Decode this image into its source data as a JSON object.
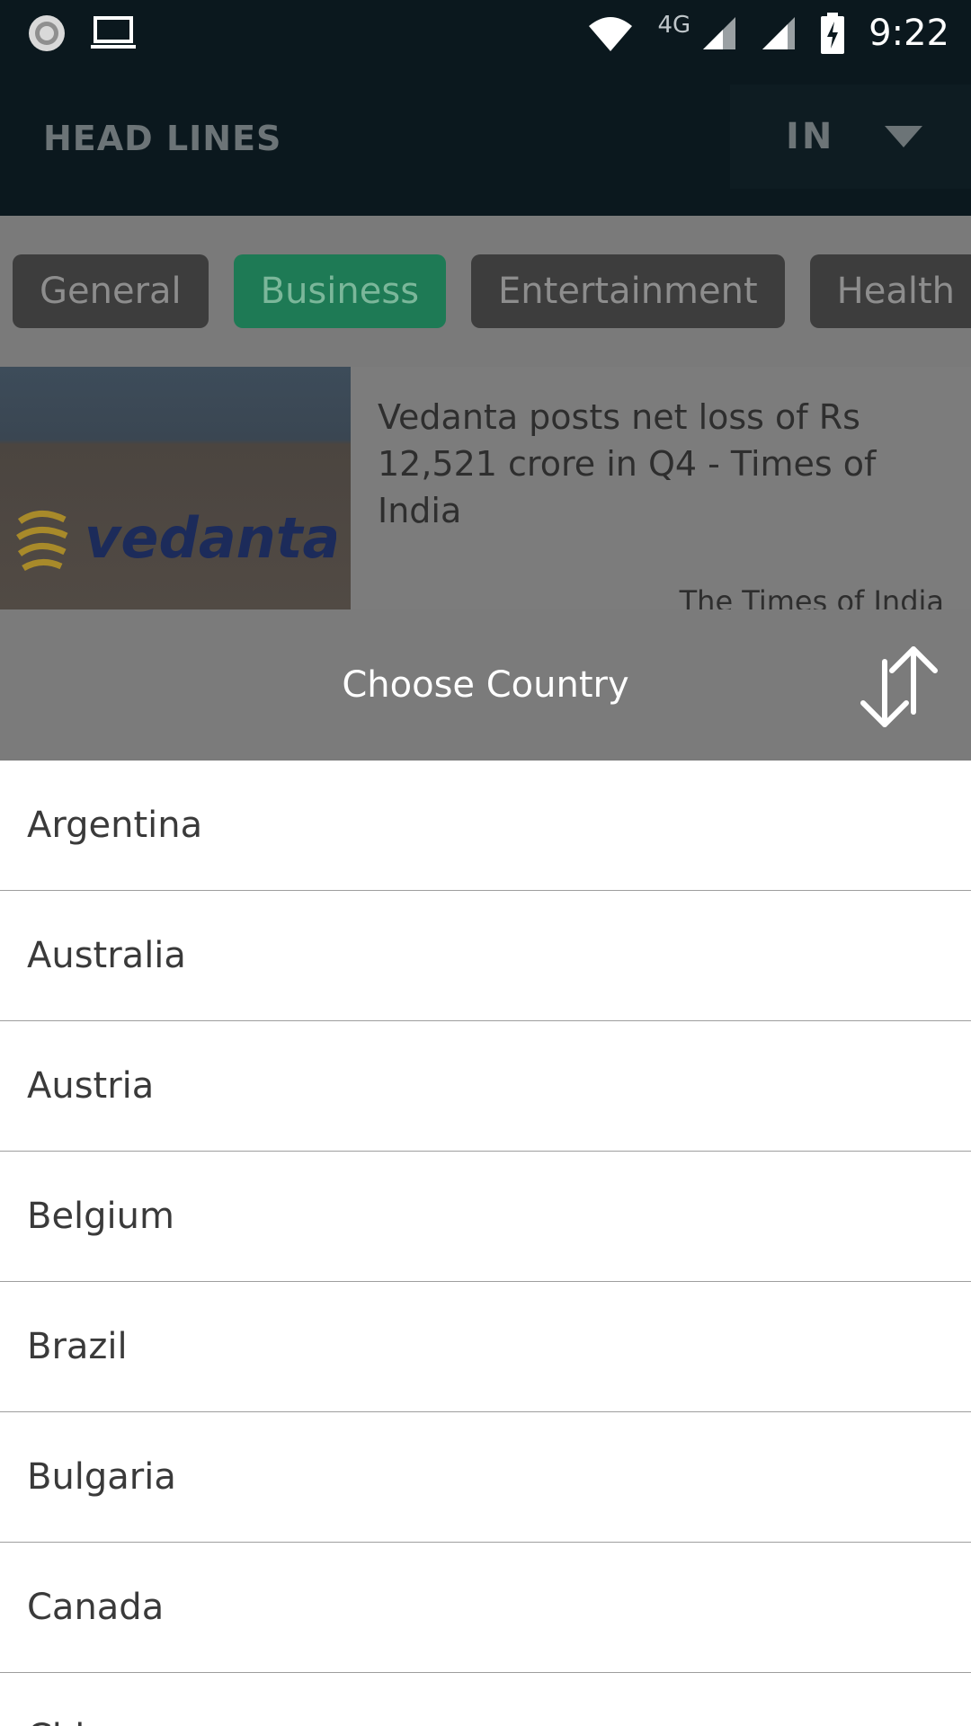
{
  "status_bar": {
    "network_label": "4G",
    "time": "9:22",
    "icons": [
      "sync-icon",
      "laptop-icon",
      "wifi-icon",
      "signal-icon",
      "signal-icon",
      "battery-charging-icon"
    ]
  },
  "app_bar": {
    "title": "HEAD LINES",
    "country_code": "IN"
  },
  "categories": [
    {
      "label": "General"
    },
    {
      "label": "Business"
    },
    {
      "label": "Entertainment"
    },
    {
      "label": "Health"
    }
  ],
  "article": {
    "headline": "Vedanta posts net loss of Rs 12,521 crore in Q4 - Times of India",
    "source": "The Times of India",
    "image_logo_text": "vedanta"
  },
  "country_sheet": {
    "title": "Choose Country",
    "countries": [
      "Argentina",
      "Australia",
      "Austria",
      "Belgium",
      "Brazil",
      "Bulgaria",
      "Canada",
      "China"
    ]
  },
  "colors": {
    "status_bar_bg": "#0b181e",
    "active_chip": "#1e7a55",
    "chip_bg": "#3d3d3d",
    "overlay_grey": "#7b7b7b"
  }
}
